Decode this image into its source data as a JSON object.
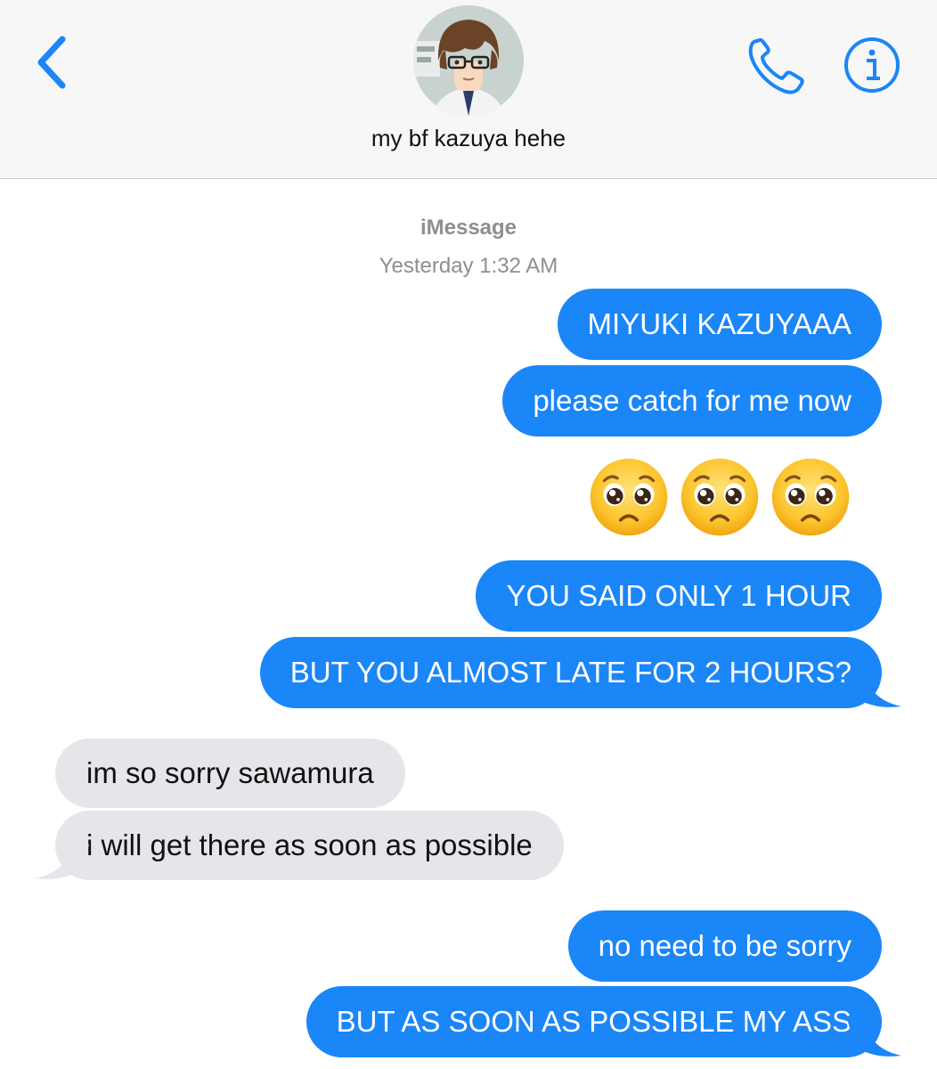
{
  "header": {
    "contact_name": "my bf kazuya hehe",
    "back_icon": "chevron-left-icon",
    "phone_icon": "phone-icon",
    "info_icon": "info-icon",
    "accent_color": "#1a86f7"
  },
  "conversation": {
    "service_label": "iMessage",
    "timestamp": "Yesterday 1:32 AM",
    "messages": [
      {
        "sender": "me",
        "text": "MIYUKI KAZUYAAA"
      },
      {
        "sender": "me",
        "text": "please catch for me now"
      },
      {
        "sender": "me",
        "emoji": [
          "pleading-face",
          "pleading-face",
          "pleading-face"
        ]
      },
      {
        "sender": "me",
        "text": "YOU SAID ONLY 1 HOUR"
      },
      {
        "sender": "me",
        "text": "BUT YOU ALMOST LATE FOR 2 HOURS?"
      },
      {
        "sender": "them",
        "text": "im so sorry sawamura"
      },
      {
        "sender": "them",
        "text": "i will get there as soon as possible"
      },
      {
        "sender": "me",
        "text": "no need to be sorry"
      },
      {
        "sender": "me",
        "text": "BUT AS SOON AS POSSIBLE MY ASS"
      }
    ]
  },
  "colors": {
    "sent_bubble": "#1a86f7",
    "received_bubble": "#e5e5ea",
    "meta_text": "#8e8e93"
  }
}
